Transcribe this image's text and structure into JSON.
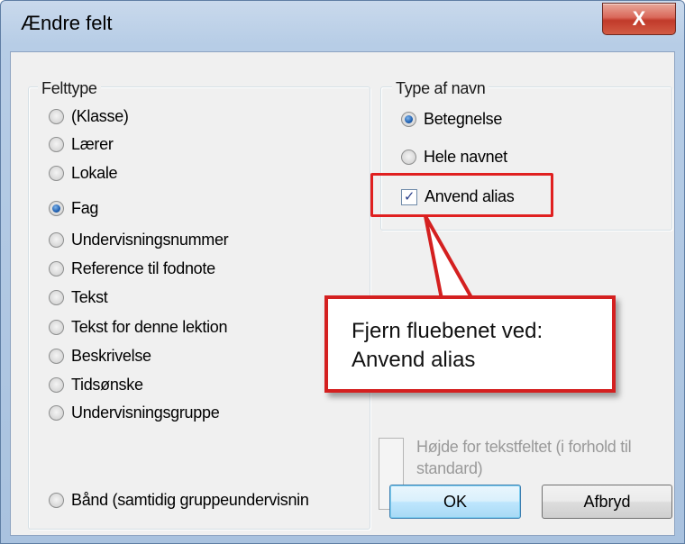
{
  "window": {
    "title": "Ændre felt",
    "close_label": "X"
  },
  "felttype": {
    "label": "Felttype",
    "options": [
      {
        "label": "(Klasse)",
        "checked": false
      },
      {
        "label": "Lærer",
        "checked": false
      },
      {
        "label": "Lokale",
        "checked": false
      },
      {
        "label": "Fag",
        "checked": true
      },
      {
        "label": "Undervisningsnummer",
        "checked": false
      },
      {
        "label": "Reference til fodnote",
        "checked": false
      },
      {
        "label": "Tekst",
        "checked": false
      },
      {
        "label": "Tekst for denne lektion",
        "checked": false
      },
      {
        "label": "Beskrivelse",
        "checked": false
      },
      {
        "label": "Tidsønske",
        "checked": false
      },
      {
        "label": "Undervisningsgruppe",
        "checked": false
      },
      {
        "label": "Bånd (samtidig gruppeundervisnin",
        "checked": false
      }
    ]
  },
  "type_af_navn": {
    "label": "Type af navn",
    "options": [
      {
        "label": "Betegnelse",
        "checked": true
      },
      {
        "label": "Hele navnet",
        "checked": false
      }
    ],
    "alias_checkbox": {
      "label": "Anvend alias",
      "checked": true
    }
  },
  "callout": {
    "line1": "Fjern fluebenet ved:",
    "line2": "Anvend alias",
    "color": "#d42020"
  },
  "height_option": {
    "label": "Højde for tekstfeltet (i forhold til standard)",
    "enabled": false
  },
  "buttons": {
    "ok": "OK",
    "cancel": "Afbryd"
  }
}
